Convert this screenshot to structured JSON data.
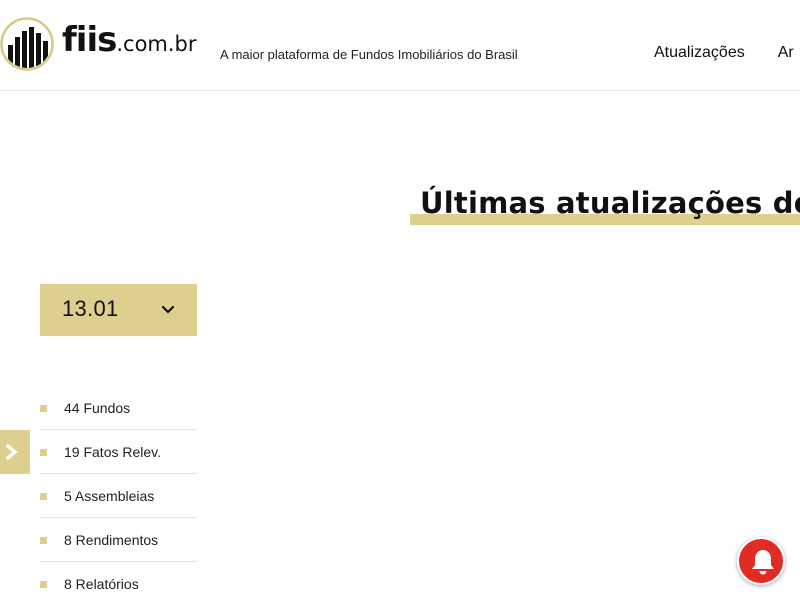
{
  "header": {
    "logo_name": "fiis",
    "logo_domain": ".com.br",
    "tagline": "A maior plataforma de Fundos Imobiliários do Brasil",
    "nav": [
      {
        "label": "Atualizações"
      },
      {
        "label": "Ar"
      }
    ]
  },
  "main": {
    "title": "Últimas atualizações dos"
  },
  "sidebar": {
    "date_select": {
      "value": "13.01",
      "icon": "chevron-down-icon"
    },
    "toggle_icon": "chevron-right-icon",
    "categories": [
      {
        "label": "44 Fundos"
      },
      {
        "label": "19 Fatos Relev."
      },
      {
        "label": "5 Assembleias"
      },
      {
        "label": "8 Rendimentos"
      },
      {
        "label": "8 Relatórios"
      }
    ]
  },
  "notification": {
    "icon": "bell-icon"
  },
  "colors": {
    "accent": "#ddd08e",
    "text": "#111111",
    "notification": "#e22b25"
  }
}
